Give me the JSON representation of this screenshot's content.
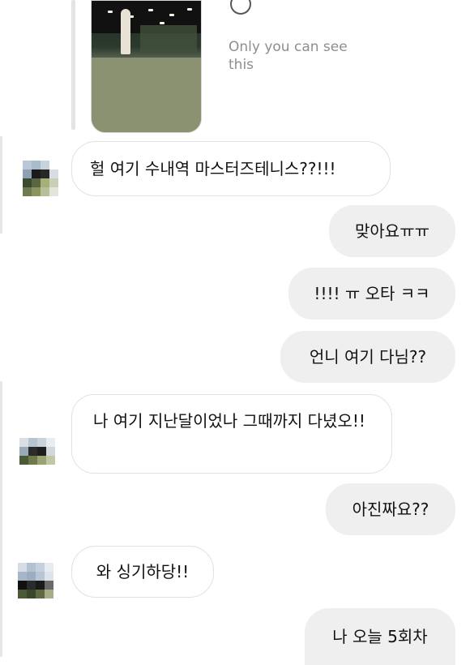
{
  "top": {
    "status_text": "Only you can see this",
    "icon": "undo-icon"
  },
  "messages": [
    {
      "side": "in",
      "text": "헐 여기 수내역 마스터즈테니스??!!!"
    },
    {
      "side": "out",
      "text": "맞아요ㅠㅠ"
    },
    {
      "side": "out",
      "text": "!!!! ㅠ 오타 ㅋㅋ"
    },
    {
      "side": "out",
      "text": "언니 여기 다님??"
    },
    {
      "side": "in",
      "text": "나 여기 지난달이었나 그때까지 다녔오!!"
    },
    {
      "side": "out",
      "text": "아진짜요??"
    },
    {
      "side": "in",
      "text": "와 싱기하당!!"
    },
    {
      "side": "out",
      "text": "나 오늘 5회차"
    }
  ]
}
